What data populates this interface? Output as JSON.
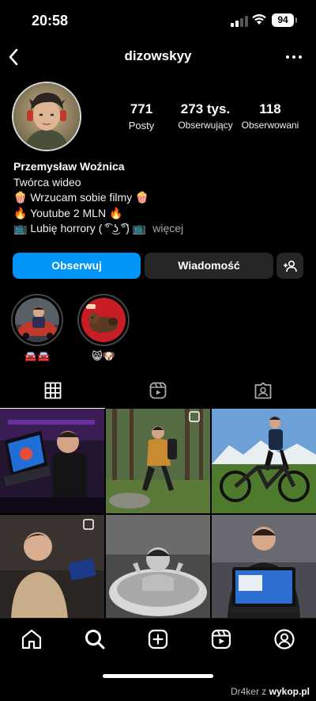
{
  "status_bar": {
    "time": "20:58",
    "battery": "94"
  },
  "header": {
    "username": "dizowskyy",
    "back_icon": "chevron-left-icon",
    "more_icon": "more-horizontal-icon"
  },
  "stats": [
    {
      "value": "771",
      "label": "Posty"
    },
    {
      "value": "273 tys.",
      "label": "Obserwujący"
    },
    {
      "value": "118",
      "label": "Obserwowani"
    }
  ],
  "bio": {
    "name": "Przemysław Woźnica",
    "category": "Twórca wideo",
    "lines": [
      "🍿 Wrzucam sobie filmy 🍿",
      "🔥 Youtube 2 MLN 🔥",
      "📺 Lubię horrory ( ͡° ͜ʖ ͡°) 📺"
    ],
    "more": "więcej"
  },
  "buttons": {
    "follow": "Obserwuj",
    "message": "Wiadomość"
  },
  "highlights": [
    {
      "label": "🚘🚘"
    },
    {
      "label": "😸🐶"
    }
  ],
  "tabs": [
    "grid-icon",
    "reels-icon",
    "tagged-icon"
  ],
  "nav": [
    "home-icon",
    "search-icon",
    "create-icon",
    "reels-icon",
    "profile-icon"
  ],
  "watermark": {
    "prefix": "Dr4ker z",
    "brand": "wykop.pl"
  },
  "colors": {
    "accent": "#0095f6",
    "secondary_button": "#262626",
    "background": "#000000"
  }
}
